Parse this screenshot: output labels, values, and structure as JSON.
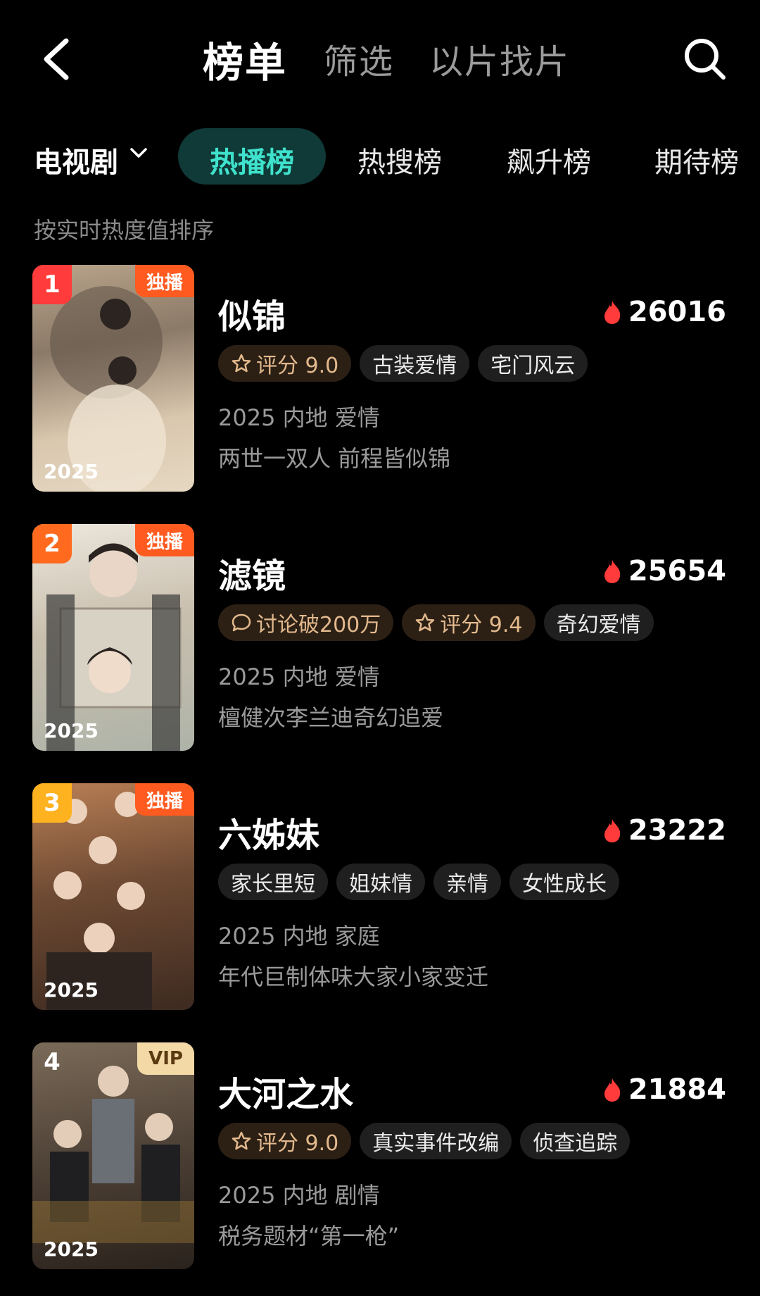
{
  "header": {
    "tabs": [
      "榜单",
      "筛选",
      "以片找片"
    ]
  },
  "subbar": {
    "category": "电视剧",
    "tabs": [
      "热播榜",
      "热搜榜",
      "飙升榜",
      "期待榜"
    ]
  },
  "hint": "按实时热度值排序",
  "colors": {
    "accent": "#3fe2cc",
    "heat": "#ff3b3b",
    "exclusive": "#ff5a1f",
    "vip": "#f2d9a6"
  },
  "items": [
    {
      "rank": "1",
      "badge": "独播",
      "badge_type": "exclusive",
      "year": "2025",
      "title": "似锦",
      "heat": "26016",
      "tags": [
        {
          "text": "评分 9.0",
          "icon": "star-icon"
        },
        {
          "text": "古装爱情"
        },
        {
          "text": "宅门风云"
        }
      ],
      "meta": "2025 内地 爱情",
      "desc": "两世一双人 前程皆似锦"
    },
    {
      "rank": "2",
      "badge": "独播",
      "badge_type": "exclusive",
      "year": "2025",
      "title": "滤镜",
      "heat": "25654",
      "tags": [
        {
          "text": "讨论破200万",
          "icon": "comment-icon"
        },
        {
          "text": "评分 9.4",
          "icon": "star-icon"
        },
        {
          "text": "奇幻爱情"
        }
      ],
      "meta": "2025 内地 爱情",
      "desc": "檀健次李兰迪奇幻追爱"
    },
    {
      "rank": "3",
      "badge": "独播",
      "badge_type": "exclusive",
      "year": "2025",
      "title": "六姊妹",
      "heat": "23222",
      "tags": [
        {
          "text": "家长里短"
        },
        {
          "text": "姐妹情"
        },
        {
          "text": "亲情"
        },
        {
          "text": "女性成长"
        }
      ],
      "meta": "2025 内地 家庭",
      "desc": "年代巨制体味大家小家变迁"
    },
    {
      "rank": "4",
      "badge": "VIP",
      "badge_type": "vip",
      "year": "2025",
      "title": "大河之水",
      "heat": "21884",
      "tags": [
        {
          "text": "评分 9.0",
          "icon": "star-icon"
        },
        {
          "text": "真实事件改编"
        },
        {
          "text": "侦查追踪"
        }
      ],
      "meta": "2025 内地 剧情",
      "desc": "税务题材“第一枪”"
    }
  ]
}
